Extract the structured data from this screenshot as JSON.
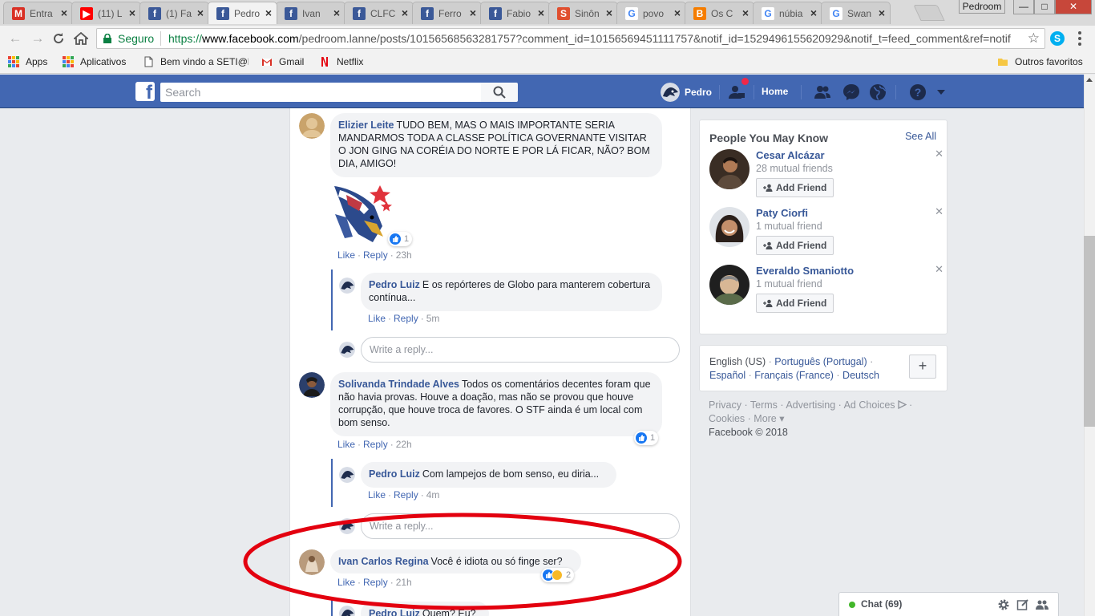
{
  "browser": {
    "tabs": [
      {
        "icon": "gmail-icon",
        "label": "Entra",
        "color": "#d93025",
        "active": false
      },
      {
        "icon": "youtube-icon",
        "label": "(11) L",
        "color": "#ff0000",
        "active": false
      },
      {
        "icon": "facebook-icon",
        "label": "(1) Fa",
        "color": "#3b5998",
        "active": false
      },
      {
        "icon": "facebook-icon",
        "label": "Pedro",
        "color": "#3b5998",
        "active": true
      },
      {
        "icon": "facebook-icon",
        "label": "Ivan",
        "color": "#3b5998",
        "active": false
      },
      {
        "icon": "facebook-icon",
        "label": "CLFC",
        "color": "#3b5998",
        "active": false
      },
      {
        "icon": "facebook-icon",
        "label": "Ferro",
        "color": "#3b5998",
        "active": false
      },
      {
        "icon": "facebook-icon",
        "label": "Fabio",
        "color": "#3b5998",
        "active": false
      },
      {
        "icon": "sinonimos-icon",
        "label": "Sinôn",
        "color": "#e04f2f",
        "active": false
      },
      {
        "icon": "google-icon",
        "label": "povo",
        "color": "#4285f4",
        "active": false
      },
      {
        "icon": "blogger-icon",
        "label": "Os C",
        "color": "#f57d00",
        "active": false
      },
      {
        "icon": "google-icon",
        "label": "núbia",
        "color": "#4285f4",
        "active": false
      },
      {
        "icon": "google-icon",
        "label": "Swan",
        "color": "#4285f4",
        "active": false
      }
    ],
    "profile_name": "Pedroom",
    "secure_label": "Seguro",
    "url_scheme": "https://",
    "url_domain": "www.facebook.com",
    "url_path": "/pedroom.lanne/posts/10156568563281757?comment_id=10156569451111757&notif_id=1529496155620929&notif_t=feed_comment&ref=notif",
    "bookmarks": [
      {
        "icon": "apps-grid-icon",
        "label": "Apps"
      },
      {
        "icon": "apps-grid-icon",
        "label": "Aplicativos"
      },
      {
        "icon": "page-icon",
        "label": "Bem vindo a SETI@h"
      },
      {
        "icon": "gmail-icon",
        "label": "Gmail"
      },
      {
        "icon": "netflix-icon",
        "label": "Netflix"
      }
    ],
    "other_bookmarks": "Outros favoritos"
  },
  "fb": {
    "search_placeholder": "Search",
    "user_name": "Pedro",
    "home_label": "Home",
    "brand_color": "#4267b2",
    "link_color": "#385898"
  },
  "comments": {
    "c1": {
      "name": "Elizier Leite",
      "text": "TUDO BEM, MAS O MAIS IMPORTANTE SERIA MANDARMOS TODA A CLASSE POLÍTICA GOVERNANTE VISITAR O JON GING NA CORÉIA DO NORTE E POR LÁ FICAR, NÃO? BOM DIA, AMIGO!",
      "reaction_count": "1",
      "like": "Like",
      "reply": "Reply",
      "time": "23h"
    },
    "r1": {
      "name": "Pedro Luiz",
      "text": "E os repórteres de Globo para manterem cobertura contínua...",
      "like": "Like",
      "reply": "Reply",
      "time": "5m"
    },
    "c2": {
      "name": "Solivanda Trindade Alves",
      "text": "Todos os comentários decentes foram que não havia provas. Houve a doação, mas não se provou que houve corrupção, que houve troca de favores. O STF ainda é um local com bom senso.",
      "reaction_count": "1",
      "like": "Like",
      "reply": "Reply",
      "time": "22h"
    },
    "r2": {
      "name": "Pedro Luiz",
      "text": "Com lampejos de bom senso, eu diria...",
      "like": "Like",
      "reply": "Reply",
      "time": "4m"
    },
    "c3": {
      "name": "Ivan Carlos Regina",
      "text": "Você é idiota ou só finge ser?",
      "reaction_count": "2",
      "like": "Like",
      "reply": "Reply",
      "time": "21h"
    },
    "r3": {
      "name": "Pedro Luiz",
      "text": "Quem? Eu?"
    },
    "reply_placeholder": "Write a reply..."
  },
  "sidebar": {
    "pymk_title": "People You May Know",
    "see_all": "See All",
    "add_friend": "Add Friend",
    "people": [
      {
        "name": "Cesar Alcázar",
        "mutual": "28 mutual friends"
      },
      {
        "name": "Paty Ciorfi",
        "mutual": "1 mutual friend"
      },
      {
        "name": "Everaldo Smaniotto",
        "mutual": "1 mutual friend"
      }
    ],
    "languages": {
      "en": "English (US)",
      "pt": "Português (Portugal)",
      "es": "Español",
      "fr": "Français (France)",
      "de": "Deutsch"
    },
    "footer": {
      "privacy": "Privacy",
      "terms": "Terms",
      "advertising": "Advertising",
      "ad_choices": "Ad Choices",
      "cookies": "Cookies",
      "more": "More",
      "copyright": "Facebook © 2018"
    }
  },
  "chat": {
    "label": "Chat (69)"
  }
}
